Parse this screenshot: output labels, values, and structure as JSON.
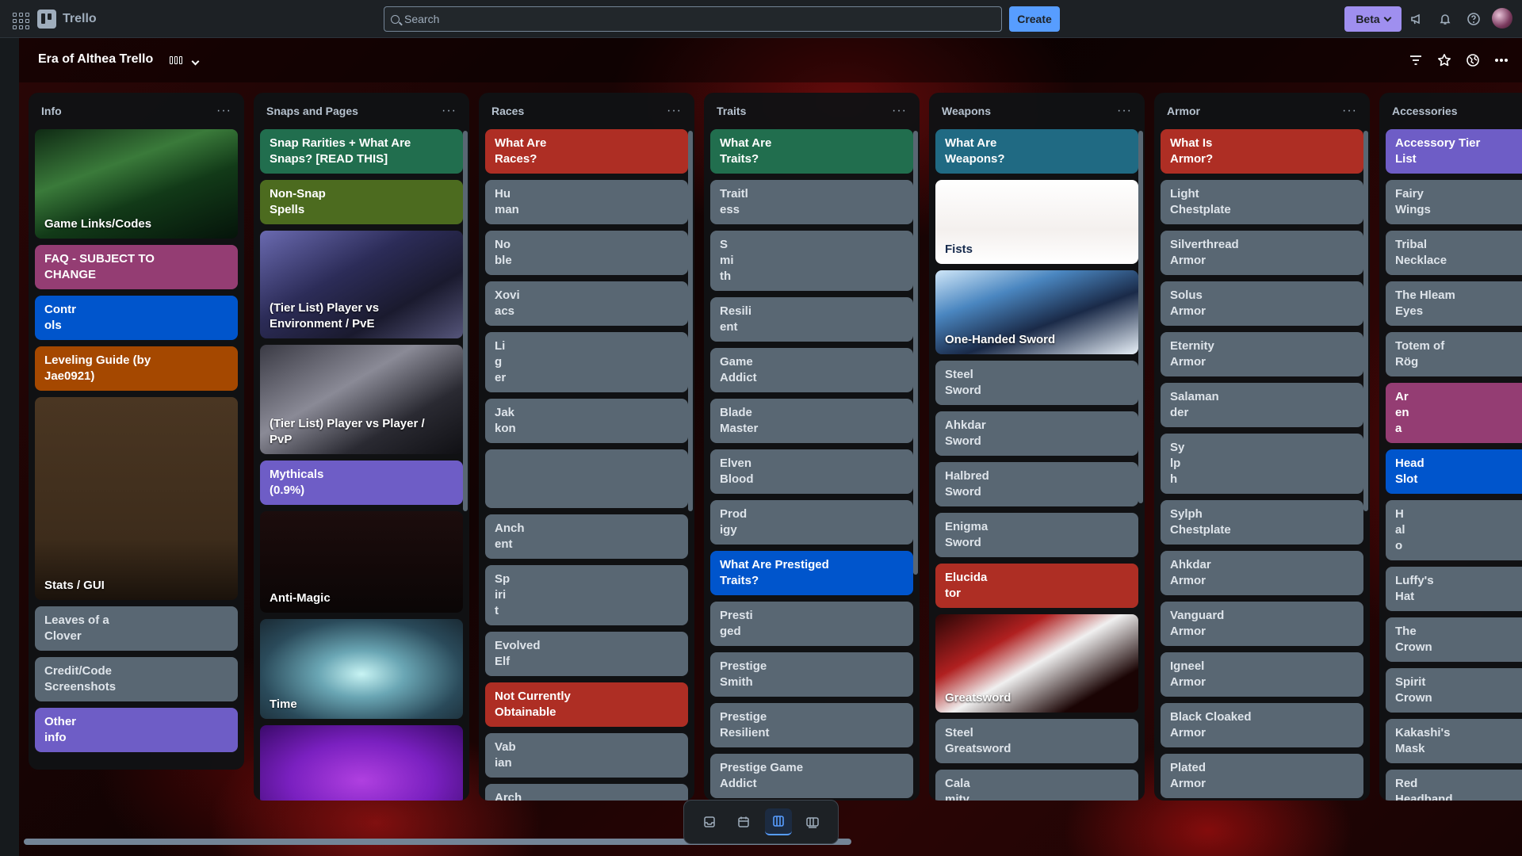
{
  "app": {
    "name": "Trello"
  },
  "search": {
    "placeholder": "Search"
  },
  "topbar": {
    "create_label": "Create",
    "beta_label": "Beta"
  },
  "board": {
    "title": "Era of Althea Trello"
  },
  "colors": {
    "green": "#216e4e",
    "lime": "#4c6b1f",
    "purple": "#6e5dc6",
    "red": "#ae2e24",
    "blue": "#0055cc",
    "magenta": "#943d73",
    "orange": "#a54800",
    "teal": "#206a83",
    "gray": "#596773",
    "violet": "#6e5dc6"
  },
  "lists": [
    {
      "title": "Info",
      "cards": [
        {
          "label": "Game Links/Codes",
          "type": "image",
          "image": "anime-green"
        },
        {
          "label": "FAQ - SUBJECT TO\nCHANGE",
          "color": "magenta"
        },
        {
          "label": "Contr\nols",
          "color": "blue"
        },
        {
          "label": "Leveling Guide (by\nJae0921)",
          "color": "orange"
        },
        {
          "label": "Stats / GUI",
          "type": "image",
          "image": "brown"
        },
        {
          "label": "Leaves of a\nClover",
          "color": "gray"
        },
        {
          "label": "Credit/Code\nScreenshots",
          "color": "gray"
        },
        {
          "label": "Other\ninfo",
          "color": "purple"
        }
      ]
    },
    {
      "title": "Snaps and Pages",
      "cards": [
        {
          "label": "Snap Rarities + What Are\nSnaps? [READ THIS]",
          "color": "green"
        },
        {
          "label": "Non-Snap\nSpells",
          "color": "lime"
        },
        {
          "label": "(Tier List) Player vs\nEnvironment / PvE",
          "type": "image",
          "image": "anime-dark"
        },
        {
          "label": "(Tier List) Player vs Player /\nPvP",
          "type": "image",
          "image": "anime-dark2"
        },
        {
          "label": "Mythicals\n(0.9%)",
          "color": "purple"
        },
        {
          "label": "Anti-Magic",
          "type": "image",
          "image": "black"
        },
        {
          "label": "Time",
          "type": "image",
          "image": "cyan"
        },
        {
          "label": "",
          "type": "image",
          "image": "violet-glow"
        }
      ]
    },
    {
      "title": "Races",
      "cards": [
        {
          "label": "What Are\nRaces?",
          "color": "red"
        },
        {
          "label": "Hu\nman",
          "color": "gray"
        },
        {
          "label": "No\nble",
          "color": "gray"
        },
        {
          "label": "Xovi\nacs",
          "color": "gray"
        },
        {
          "label": "Li\ng\ner",
          "color": "gray"
        },
        {
          "label": "Jak\nkon",
          "color": "gray"
        },
        {
          "label": "",
          "color": "gray",
          "tall": true
        },
        {
          "label": "Anch\nent",
          "color": "gray"
        },
        {
          "label": "Sp\niri\nt",
          "color": "gray"
        },
        {
          "label": "Evolved\nElf",
          "color": "gray"
        },
        {
          "label": "Not Currently\nObtainable",
          "color": "red"
        },
        {
          "label": "Vab\nian",
          "color": "gray"
        },
        {
          "label": "Arch",
          "color": "gray"
        }
      ]
    },
    {
      "title": "Traits",
      "cards": [
        {
          "label": "What Are\nTraits?",
          "color": "green"
        },
        {
          "label": "Traitl\ness",
          "color": "gray"
        },
        {
          "label": "S\nmi\nth",
          "color": "gray"
        },
        {
          "label": "Resili\nent",
          "color": "gray"
        },
        {
          "label": "Game\nAddict",
          "color": "gray"
        },
        {
          "label": "Blade\nMaster",
          "color": "gray"
        },
        {
          "label": "Elven\nBlood",
          "color": "gray"
        },
        {
          "label": "Prod\nigy",
          "color": "gray"
        },
        {
          "label": "What Are Prestiged\nTraits?",
          "color": "blue"
        },
        {
          "label": "Presti\nged",
          "color": "gray"
        },
        {
          "label": "Prestige\nSmith",
          "color": "gray"
        },
        {
          "label": "Prestige\nResilient",
          "color": "gray"
        },
        {
          "label": "Prestige Game\nAddict",
          "color": "gray"
        }
      ]
    },
    {
      "title": "Weapons",
      "cards": [
        {
          "label": "What Are\nWeapons?",
          "color": "teal"
        },
        {
          "label": "Fists",
          "type": "image",
          "image": "white"
        },
        {
          "label": "One-Handed Sword",
          "type": "image",
          "image": "anime-blue"
        },
        {
          "label": "Steel\nSword",
          "color": "gray"
        },
        {
          "label": "Ahkdar\nSword",
          "color": "gray"
        },
        {
          "label": "Halbred\nSword",
          "color": "gray"
        },
        {
          "label": "Enigma\nSword",
          "color": "gray"
        },
        {
          "label": "Elucida\ntor",
          "color": "red"
        },
        {
          "label": "Greatsword",
          "type": "image",
          "image": "anime-red"
        },
        {
          "label": "Steel\nGreatsword",
          "color": "gray"
        },
        {
          "label": "Cala\nmity",
          "color": "gray"
        }
      ]
    },
    {
      "title": "Armor",
      "cards": [
        {
          "label": "What Is\nArmor?",
          "color": "red"
        },
        {
          "label": "Light\nChestplate",
          "color": "gray"
        },
        {
          "label": "Silverthread\nArmor",
          "color": "gray"
        },
        {
          "label": "Solus\nArmor",
          "color": "gray"
        },
        {
          "label": "Eternity\nArmor",
          "color": "gray"
        },
        {
          "label": "Salaman\nder",
          "color": "gray"
        },
        {
          "label": "Sy\nlp\nh",
          "color": "gray"
        },
        {
          "label": "Sylph\nChestplate",
          "color": "gray"
        },
        {
          "label": "Ahkdar\nArmor",
          "color": "gray"
        },
        {
          "label": "Vanguard\nArmor",
          "color": "gray"
        },
        {
          "label": "Igneel\nArmor",
          "color": "gray"
        },
        {
          "label": "Black Cloaked\nArmor",
          "color": "gray"
        },
        {
          "label": "Plated\nArmor",
          "color": "gray"
        }
      ]
    },
    {
      "title": "Accessories",
      "cards": [
        {
          "label": "Accessory Tier\nList",
          "color": "violet"
        },
        {
          "label": "Fairy\nWings",
          "color": "gray"
        },
        {
          "label": "Tribal\nNecklace",
          "color": "gray"
        },
        {
          "label": "The Hleam\nEyes",
          "color": "gray"
        },
        {
          "label": "Totem of\nRög",
          "color": "gray"
        },
        {
          "label": "Ar\nen\na",
          "color": "magenta"
        },
        {
          "label": "Head\nSlot",
          "color": "blue"
        },
        {
          "label": "H\nal\no",
          "color": "gray"
        },
        {
          "label": "Luffy's\nHat",
          "color": "gray"
        },
        {
          "label": "The\nCrown",
          "color": "gray"
        },
        {
          "label": "Spirit\nCrown",
          "color": "gray"
        },
        {
          "label": "Kakashi's\nMask",
          "color": "gray"
        },
        {
          "label": "Red\nHeadband",
          "color": "gray"
        }
      ]
    }
  ],
  "view_switcher": {
    "views": [
      "inbox-icon",
      "calendar-icon",
      "board-icon",
      "switch-boards-icon"
    ],
    "active": 2
  }
}
